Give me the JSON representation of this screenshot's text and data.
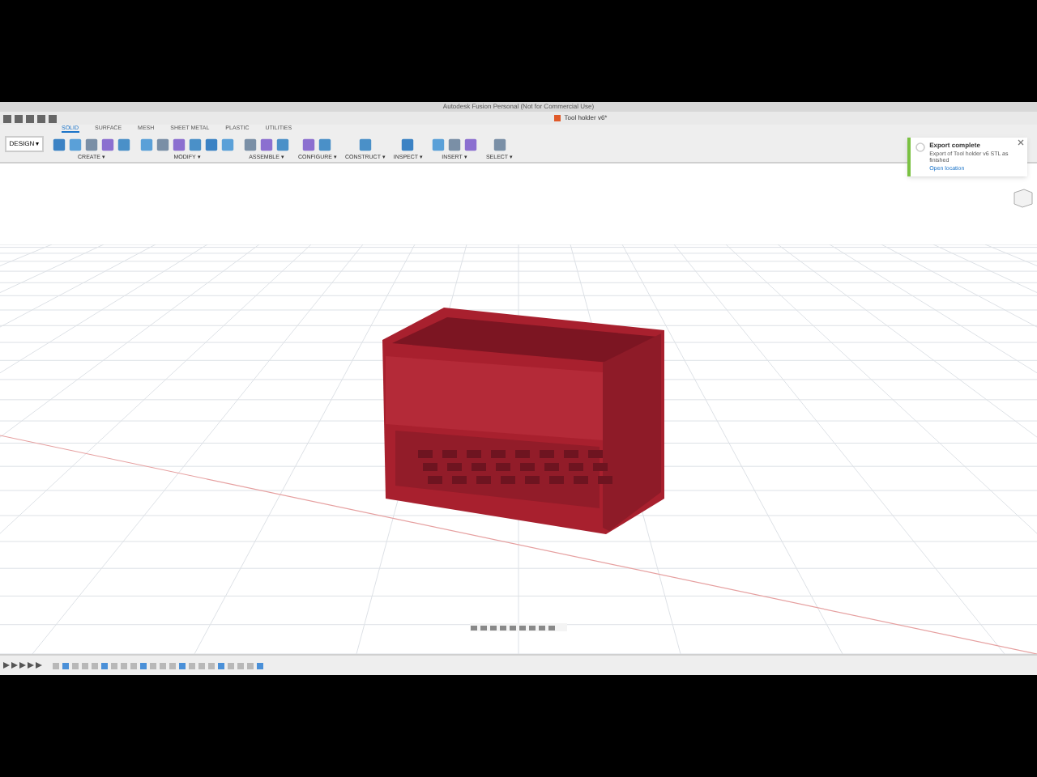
{
  "window": {
    "title": "Autodesk Fusion Personal (Not for Commercial Use)"
  },
  "document_tab": {
    "title": "Tool holder v6*"
  },
  "workspace": {
    "label": "DESIGN ▾"
  },
  "tabs": [
    {
      "label": "SOLID",
      "selected": true
    },
    {
      "label": "SURFACE",
      "selected": false
    },
    {
      "label": "MESH",
      "selected": false
    },
    {
      "label": "SHEET METAL",
      "selected": false
    },
    {
      "label": "PLASTIC",
      "selected": false
    },
    {
      "label": "UTILITIES",
      "selected": false
    }
  ],
  "tool_groups": [
    {
      "label": "CREATE ▾"
    },
    {
      "label": "MODIFY ▾"
    },
    {
      "label": "ASSEMBLE ▾"
    },
    {
      "label": "CONFIGURE ▾"
    },
    {
      "label": "CONSTRUCT ▾"
    },
    {
      "label": "INSPECT ▾"
    },
    {
      "label": "INSERT ▾"
    },
    {
      "label": "SELECT ▾"
    }
  ],
  "notification": {
    "title": "Export complete",
    "message": "Export of Tool holder v6 STL as finished",
    "link": "Open location"
  }
}
